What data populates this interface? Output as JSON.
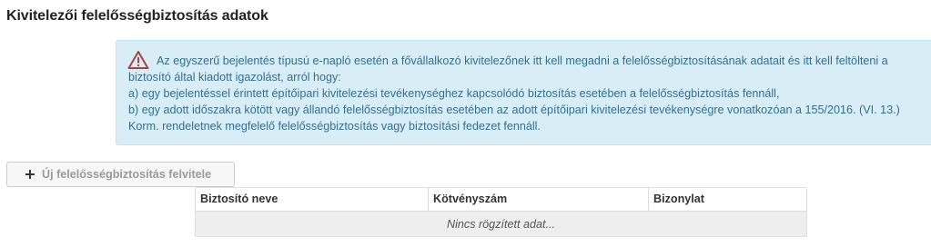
{
  "section": {
    "title": "Kivitelezői felelősségbiztosítás adatok"
  },
  "alert": {
    "icon": "warning-triangle-icon",
    "color": "#31708f",
    "background": "#d9edf7",
    "icon_color": "#a94442",
    "lines": [
      "Az egyszerű bejelentés típusú e-napló esetén a fővállalkozó kivitelezőnek itt kell megadni a felelősségbiztosításának adatait és itt kell feltölteni a",
      "biztosító által kiadott igazolást, arról hogy:",
      "a) egy bejelentéssel érintett építőipari kivitelezési tevékenységhez kapcsolódó biztosítás esetében a felelősségbiztosítás fennáll,",
      "b) egy adott időszakra kötött vagy állandó felelősségbiztosítás esetében az adott építőipari kivitelezési tevékenységre vonatkozóan a 155/2016. (VI. 13.)",
      "Korm. rendeletnek megfelelő felelősségbiztosítás vagy biztosítási fedezet fennáll."
    ]
  },
  "toolbar": {
    "add_icon": "plus-icon",
    "add_label": "Új felelősségbiztosítás felvitele"
  },
  "grid": {
    "columns": [
      "Biztosító neve",
      "Kötvényszám",
      "Bizonylat"
    ],
    "empty_text": "Nincs rögzített adat..."
  }
}
